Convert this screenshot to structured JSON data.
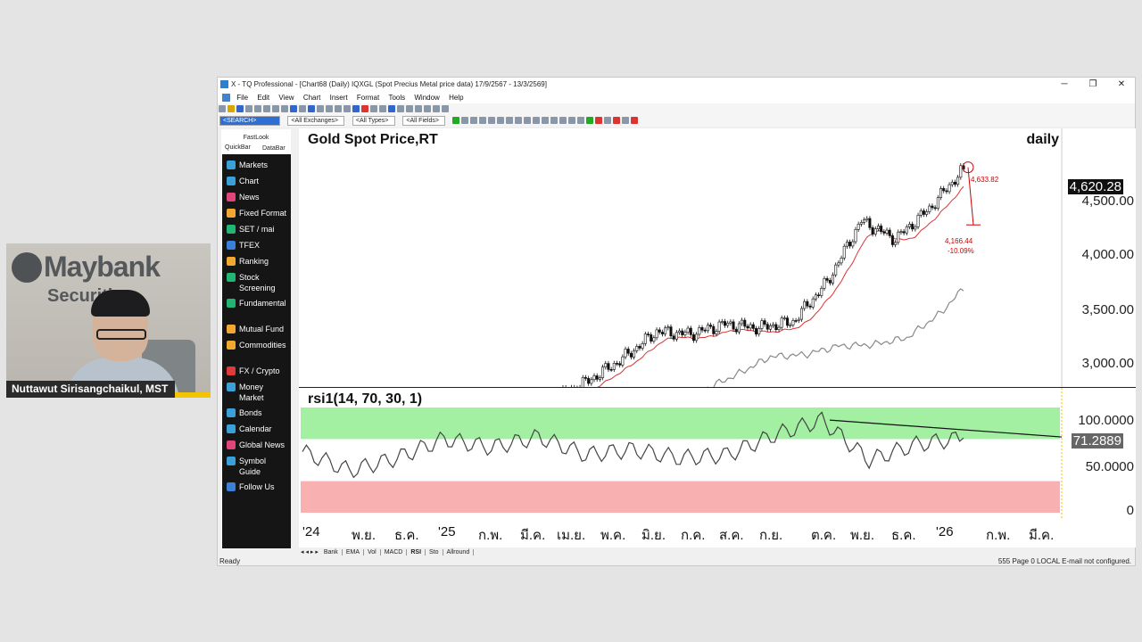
{
  "presenter": {
    "name": "Nuttawut Sirisangchaikul, MST",
    "brand": "Maybank",
    "brand_sub": "Securities"
  },
  "window": {
    "title": "X - TQ Professional - [Chart68 (Daily)  IQXGL (Spot Precius Metal price data) 17/9/2567 - 13/3/2569]",
    "controls": [
      "─",
      "❐",
      "✕"
    ]
  },
  "menu": [
    "File",
    "Edit",
    "View",
    "Chart",
    "Insert",
    "Format",
    "Tools",
    "Window",
    "Help"
  ],
  "toolbar": {
    "search_value": "<SEARCH>",
    "exchanges": "<All Exchanges>",
    "types": "<All Types>",
    "fields": "<All Fields>"
  },
  "quickbar": {
    "header": "FastLook",
    "tabs": [
      "QuickBar",
      "DataBar"
    ],
    "items": [
      {
        "label": "Markets",
        "color": "#3aa0d8"
      },
      {
        "label": "Chart",
        "color": "#3aa0d8"
      },
      {
        "label": "News",
        "color": "#e0457b"
      },
      {
        "label": "Fixed Format",
        "color": "#f0a830"
      },
      {
        "label": "SET / mai",
        "color": "#22b573"
      },
      {
        "label": "TFEX",
        "color": "#3a7fd8"
      },
      {
        "label": "Ranking",
        "color": "#f0a830"
      },
      {
        "label": "Stock Screening",
        "color": "#22b573"
      },
      {
        "label": "Fundamental",
        "color": "#22b573"
      },
      {
        "label": "Mutual Fund",
        "color": "#f0a830"
      },
      {
        "label": "Commodities",
        "color": "#f0a830"
      },
      {
        "label": "FX / Crypto",
        "color": "#e03a3a"
      },
      {
        "label": "Money Market",
        "color": "#3aa0d8"
      },
      {
        "label": "Bonds",
        "color": "#3aa0d8"
      },
      {
        "label": "Calendar",
        "color": "#3aa0d8"
      },
      {
        "label": "Global News",
        "color": "#e0457b"
      },
      {
        "label": "Symbol Guide",
        "color": "#3aa0d8"
      },
      {
        "label": "Follow Us",
        "color": "#3a7fd8"
      }
    ]
  },
  "price_pane": {
    "title": "Gold Spot Price,RT",
    "period": "daily",
    "y_ticks": [
      "4,500.00",
      "4,000.00",
      "3,500.00",
      "3,000.00"
    ],
    "last_price": "4,620.28",
    "annotations": {
      "high": "4,633.82",
      "low": "4,166.44",
      "change": "-10.09%"
    }
  },
  "rsi_pane": {
    "title": "rsi1(14, 70, 30, 1)",
    "y_ticks": [
      "100.0000",
      "50.0000",
      "0"
    ],
    "last_value": "71.2889"
  },
  "x_labels": [
    "'24",
    "พ.ย.",
    "ธ.ค.",
    "'25",
    "ก.พ.",
    "มี.ค.",
    "เม.ย.",
    "พ.ค.",
    "มิ.ย.",
    "ก.ค.",
    "ส.ค.",
    "ก.ย.",
    "ต.ค.",
    "พ.ย.",
    "ธ.ค.",
    "'26",
    "ก.พ.",
    "มี.ค."
  ],
  "bottom_tabs": [
    "Bank",
    "EMA",
    "Vol",
    "MACD",
    "RSI",
    "Sto",
    "Allround"
  ],
  "active_tab": "RSI",
  "status": {
    "left": "Ready",
    "right": "555  Page 0  LOCAL  E-mail not configured."
  },
  "chart_data": [
    {
      "type": "line",
      "title": "Gold Spot Price,RT",
      "x": [
        "2024-11",
        "2024-12",
        "2025-01",
        "2025-02",
        "2025-03",
        "2025-04",
        "2025-05",
        "2025-06",
        "2025-07",
        "2025-08",
        "2025-09",
        "2025-10",
        "2025-11",
        "2025-12",
        "2026-01"
      ],
      "series": [
        {
          "values": [
            2680,
            2640,
            2760,
            2900,
            3080,
            3300,
            3280,
            3360,
            3330,
            3380,
            3700,
            4200,
            4050,
            4300,
            4620
          ]
        }
      ],
      "ylim": [
        2850,
        4950
      ]
    },
    {
      "type": "line",
      "title": "rsi1(14, 70, 30, 1)",
      "x": [
        "2024-11",
        "2024-12",
        "2025-01",
        "2025-02",
        "2025-03",
        "2025-04",
        "2025-05",
        "2025-06",
        "2025-07",
        "2025-08",
        "2025-09",
        "2025-10",
        "2025-11",
        "2025-12",
        "2026-01"
      ],
      "series": [
        {
          "values": [
            58,
            40,
            52,
            70,
            62,
            72,
            55,
            60,
            52,
            55,
            74,
            88,
            50,
            65,
            71
          ]
        }
      ],
      "ylim": [
        0,
        100
      ],
      "bands": {
        "overbought": 70,
        "oversold": 30
      }
    }
  ]
}
